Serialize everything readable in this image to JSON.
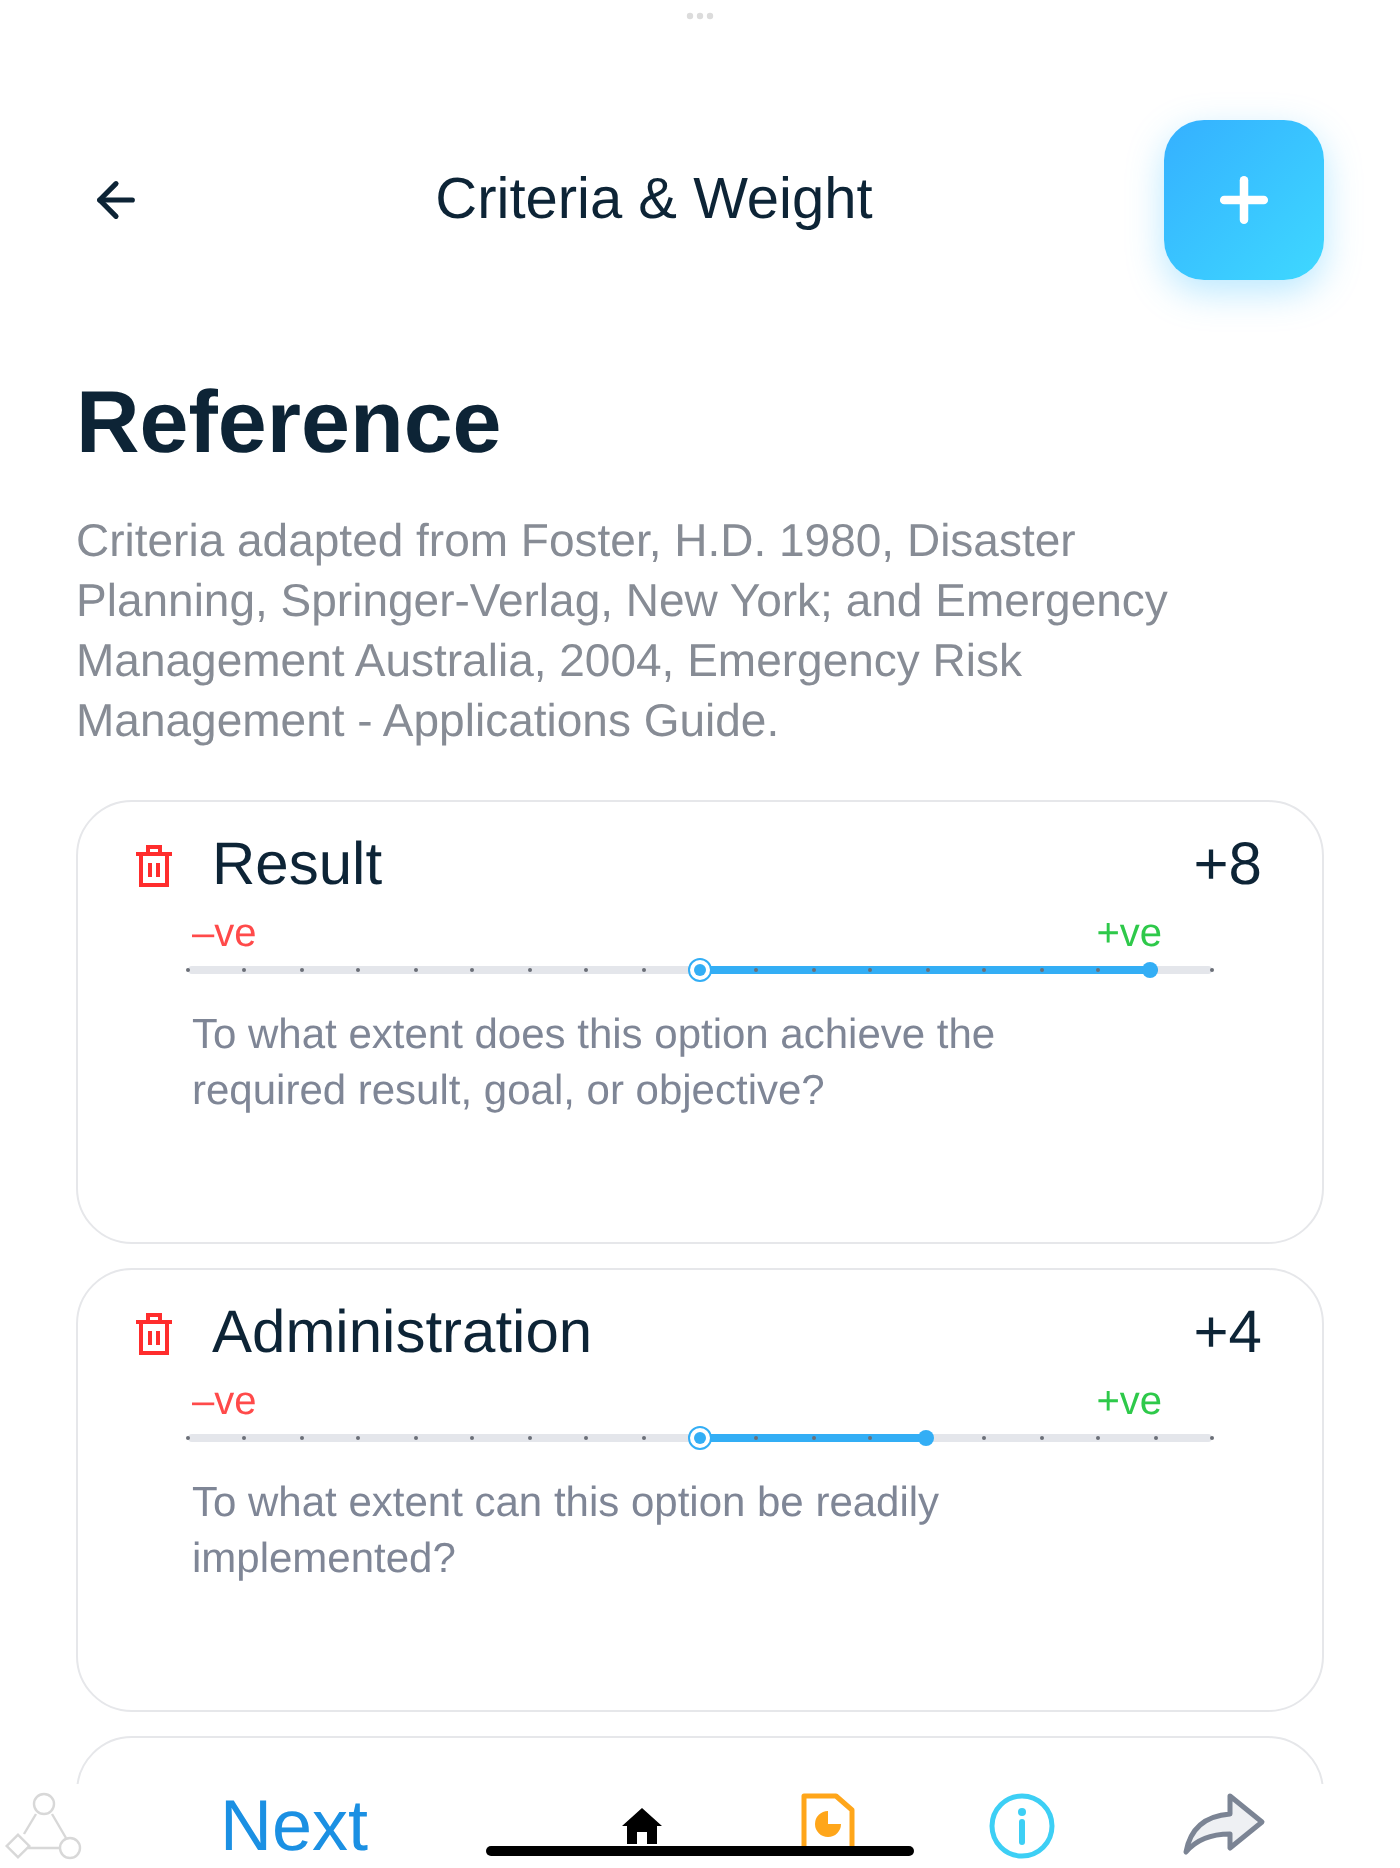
{
  "top_bar": {
    "title": "Criteria & Weight"
  },
  "reference": {
    "heading": "Reference",
    "body": "Criteria adapted from Foster, H.D. 1980, Disaster Planning, Springer-Verlag, New York; and Emergency Management Australia, 2004, Emergency Risk Management - Applications Guide."
  },
  "criteria": [
    {
      "name": "Result",
      "score": "+8",
      "negative_label": "–ve",
      "positive_label": "+ve",
      "level": 0.94,
      "description": "To what extent does this option achieve the required result, goal, or objective?"
    },
    {
      "name": "Administration",
      "score": "+4",
      "negative_label": "–ve",
      "positive_label": "+ve",
      "level": 0.72,
      "description": "To what extent can this option be readily implemented?"
    }
  ],
  "bottom_bar": {
    "next_label": "Next"
  }
}
